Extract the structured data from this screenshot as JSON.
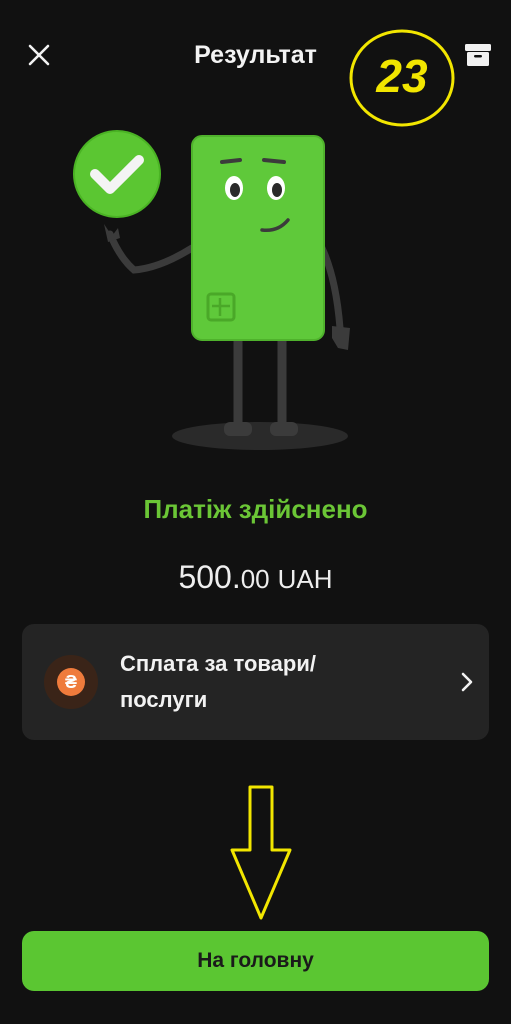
{
  "header": {
    "title": "Результат",
    "close_icon": "close-icon",
    "archive_icon": "archive-icon"
  },
  "annotation": {
    "step_number": "23",
    "color": "#f2e600"
  },
  "result": {
    "status": "Платіж здійснено",
    "amount_major": "500.",
    "amount_minor": "00",
    "currency": "UAH"
  },
  "category": {
    "line1": "Сплата за товари/",
    "line2": "послуги",
    "icon": "hryvnia-icon",
    "icon_glyph": "₴"
  },
  "actions": {
    "home_label": "На головну"
  },
  "colors": {
    "background": "#111111",
    "accent_green": "#5bc632",
    "status_green": "#6bc636",
    "card_bg": "#242424",
    "category_orange": "#ef7b3c"
  }
}
